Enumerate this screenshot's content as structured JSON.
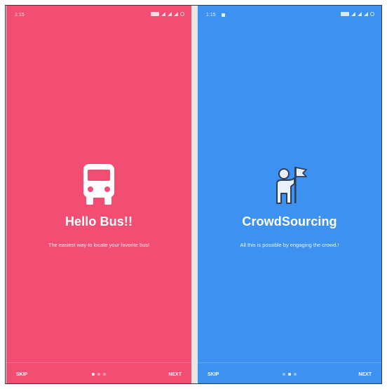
{
  "screens": [
    {
      "background": "#f24d73",
      "status_time": "1:15",
      "icon": "bus-icon",
      "title": "Hello Bus!!",
      "description": "The easiest way to locate your favorite bus!",
      "skip_label": "SKIP",
      "next_label": "NEXT",
      "active_dot": 1
    },
    {
      "background": "#3d91f0",
      "status_time": "1:15",
      "icon": "person-with-flag-icon",
      "title": "CrowdSourcing",
      "description": "All this is possible by engaging the crowd.!",
      "skip_label": "SKIP",
      "next_label": "NEXT",
      "active_dot": 2
    }
  ],
  "page_indicator_count": 3
}
